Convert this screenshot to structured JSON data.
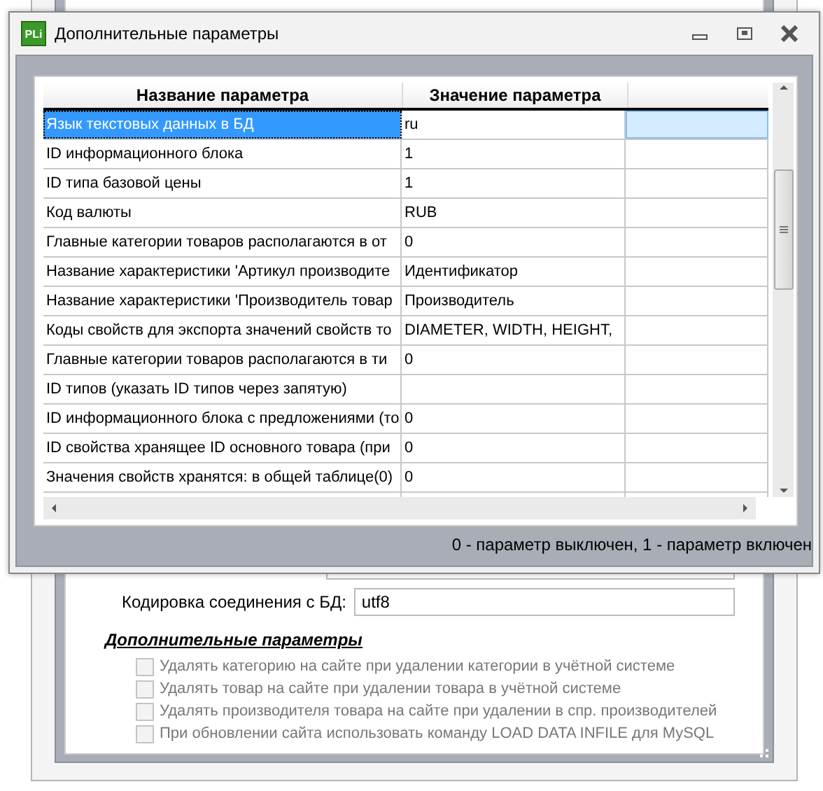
{
  "dialog": {
    "app_icon_text": "PLi",
    "title": "Дополнительные параметры",
    "table": {
      "columns": [
        "Название параметра",
        "Значение параметра"
      ],
      "rows": [
        {
          "name": "Язык текстовых данных в БД",
          "value": "ru",
          "selected": true
        },
        {
          "name": "ID информационного блока",
          "value": "1",
          "selected": false
        },
        {
          "name": "ID типа базовой цены",
          "value": "1",
          "selected": false
        },
        {
          "name": "Код валюты",
          "value": "RUB",
          "selected": false
        },
        {
          "name": "Главные категории товаров располагаются в от",
          "value": "0",
          "selected": false
        },
        {
          "name": "Название характеристики 'Артикул производите",
          "value": "Идентификатор",
          "selected": false
        },
        {
          "name": "Название характеристики 'Производитель товар",
          "value": "Производитель",
          "selected": false
        },
        {
          "name": "Коды свойств для экспорта значений свойств то",
          "value": "DIAMETER, WIDTH, HEIGHT,",
          "selected": false
        },
        {
          "name": "Главные категории товаров располагаются в ти",
          "value": "0",
          "selected": false
        },
        {
          "name": "ID типов (указать ID типов через запятую)",
          "value": "",
          "selected": false
        },
        {
          "name": "ID информационного блока с предложениями (то",
          "value": "0",
          "selected": false
        },
        {
          "name": "ID свойства хранящее ID основного товара (при",
          "value": "0",
          "selected": false
        },
        {
          "name": "Значения свойств хранятся: в общей таблице(0)",
          "value": "0",
          "selected": false
        }
      ]
    },
    "status": "0 - параметр выключен, 1 - параметр включен"
  },
  "settings": {
    "encoding_label": "Кодировка соединения с БД:",
    "encoding_value": "utf8",
    "section_title": "Дополнительные параметры",
    "options": [
      {
        "label": "Удалять категорию на сайте при удалении категории в учётной системе",
        "checked": false,
        "disabled": true
      },
      {
        "label": "Удалять товар на сайте при удалении товара в учётной системе",
        "checked": false,
        "disabled": true
      },
      {
        "label": "Удалять производителя товара на сайте при удалении в спр. производителей",
        "checked": false,
        "disabled": true
      },
      {
        "label": "При обновлении сайта использовать команду LOAD DATA INFILE для MySQL",
        "checked": false,
        "disabled": true
      }
    ]
  }
}
